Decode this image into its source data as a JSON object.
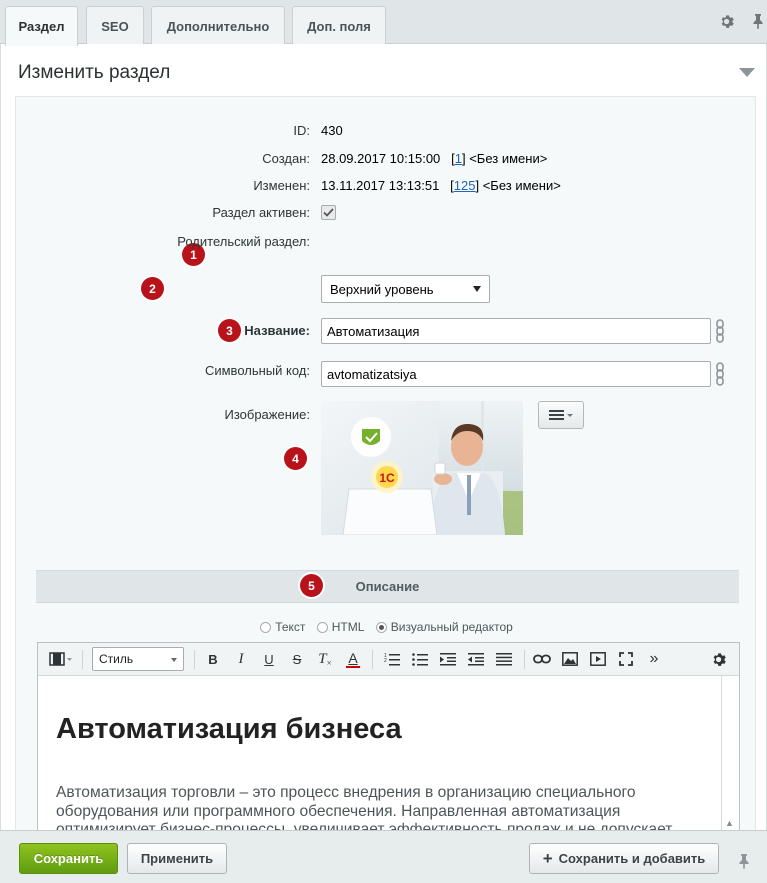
{
  "tabs": [
    {
      "label": "Раздел",
      "active": true
    },
    {
      "label": "SEO",
      "active": false
    },
    {
      "label": "Дополнительно",
      "active": false
    },
    {
      "label": "Доп. поля",
      "active": false
    }
  ],
  "icons": {
    "settings": "gear-icon",
    "pin": "pin-icon",
    "collapse": "triangle-down-icon",
    "chain": "link-chain-icon",
    "menu": "hamburger-menu-icon"
  },
  "panel": {
    "title": "Изменить раздел"
  },
  "fields": {
    "id": {
      "label": "ID:",
      "value": "430"
    },
    "created": {
      "label": "Создан:",
      "date": "28.09.2017 10:15:00",
      "user_id": "1",
      "user_name": "<Без имени>"
    },
    "modified": {
      "label": "Изменен:",
      "date": "13.11.2017 13:13:51",
      "user_id": "125",
      "user_name": "<Без имени>"
    },
    "active": {
      "label": "Раздел активен:",
      "checked": true
    },
    "parent": {
      "label": "Родительский раздел:",
      "value": "Верхний уровень"
    },
    "name": {
      "label": "Название:",
      "value": "Автоматизация"
    },
    "code": {
      "label": "Символьный код:",
      "value": "avtomatizatsiya"
    },
    "image": {
      "label": "Изображение:",
      "logo_text": "1С"
    }
  },
  "badges": [
    "1",
    "2",
    "3",
    "4",
    "5"
  ],
  "description": {
    "section_title": "Описание",
    "modes": [
      {
        "label": "Текст",
        "checked": false
      },
      {
        "label": "HTML",
        "checked": false
      },
      {
        "label": "Визуальный редактор",
        "checked": true
      }
    ]
  },
  "editor": {
    "style_label": "Стиль",
    "toolbar": {
      "bold": "B",
      "italic": "I",
      "underline": "U",
      "strike": "S",
      "clear_format": "T",
      "font_color": "A",
      "more": "»"
    },
    "heading": "Автоматизация бизнеса",
    "paragraph": "Автоматизация торговли – это процесс внедрения в организацию специального оборудования или программного обеспечения. Направленная автоматизация оптимизирует бизнес-процессы, увеличивает эффективность продаж и не допускает возникновения ошибок из-за человеческого фактора."
  },
  "footer": {
    "save": "Сохранить",
    "apply": "Применить",
    "save_add": "Сохранить и добавить",
    "plus": "+"
  },
  "colors": {
    "badge": "#b8131a",
    "save_button": "#6aa813",
    "link": "#2066b0"
  }
}
